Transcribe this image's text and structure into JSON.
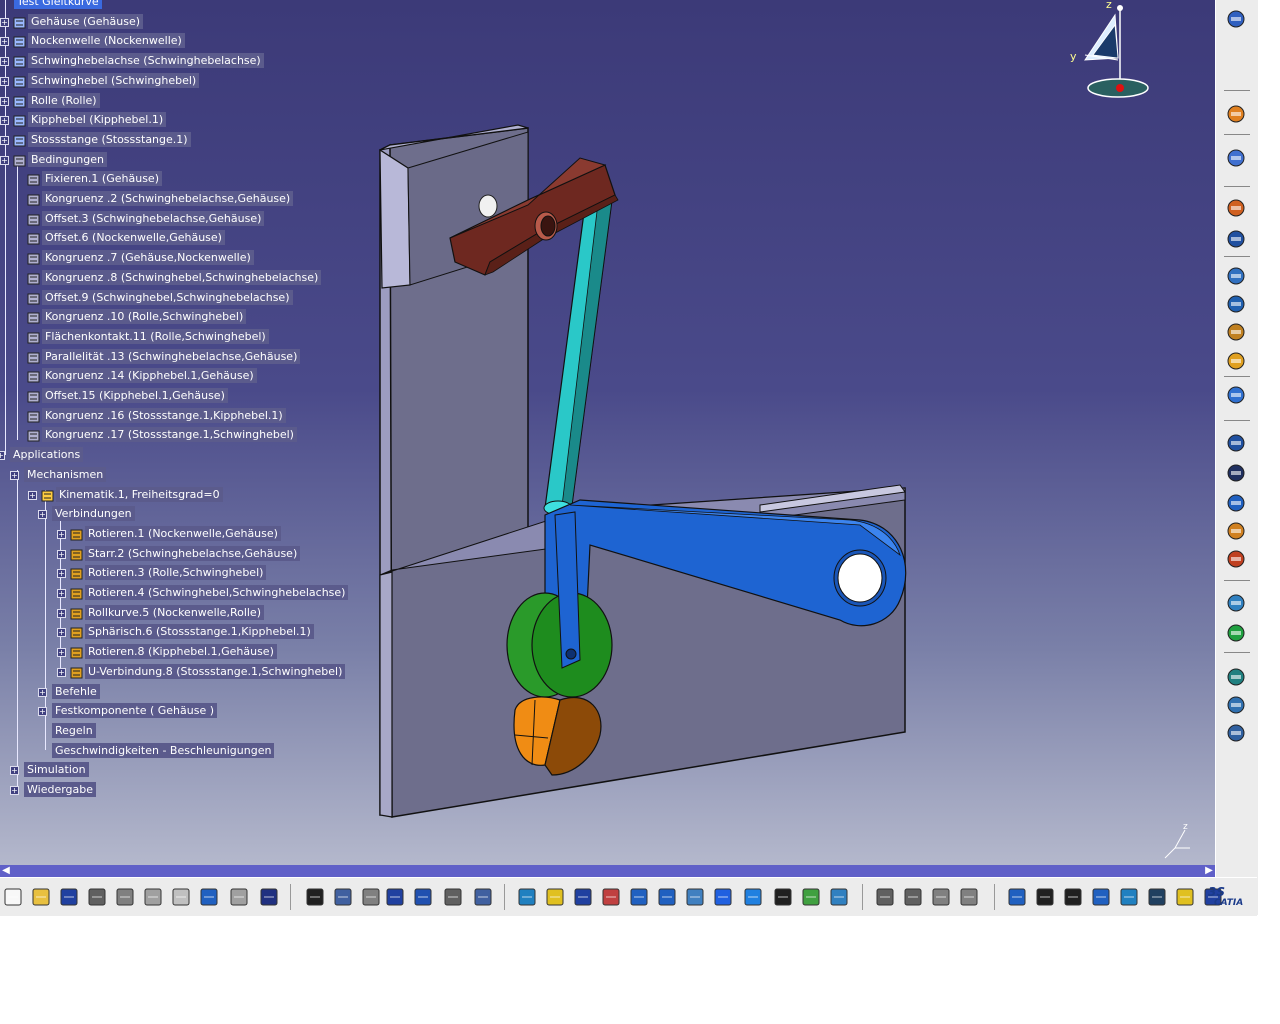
{
  "tree": {
    "root": "Test Gleitkurve",
    "parts": [
      "Gehäuse (Gehäuse)",
      "Nockenwelle (Nockenwelle)",
      "Schwinghebelachse (Schwinghebelachse)",
      "Schwinghebel (Schwinghebel)",
      "Rolle (Rolle)",
      "Kipphebel (Kipphebel.1)",
      "Stossstange (Stossstange.1)"
    ],
    "constraints_label": "Bedingungen",
    "constraints": [
      "Fixieren.1 (Gehäuse)",
      "Kongruenz .2 (Schwinghebelachse,Gehäuse)",
      "Offset.3 (Schwinghebelachse,Gehäuse)",
      "Offset.6 (Nockenwelle,Gehäuse)",
      "Kongruenz .7 (Gehäuse,Nockenwelle)",
      "Kongruenz .8 (Schwinghebel,Schwinghebelachse)",
      "Offset.9 (Schwinghebel,Schwinghebelachse)",
      "Kongruenz .10 (Rolle,Schwinghebel)",
      "Flächenkontakt.11 (Rolle,Schwinghebel)",
      "Parallelität .13 (Schwinghebelachse,Gehäuse)",
      "Kongruenz .14 (Kipphebel.1,Gehäuse)",
      "Offset.15 (Kipphebel.1,Gehäuse)",
      "Kongruenz .16 (Stossstange.1,Kipphebel.1)",
      "Kongruenz .17 (Stossstange.1,Schwinghebel)"
    ],
    "applications_label": "Applications",
    "mechanisms_label": "Mechanismen",
    "kinematics_label": "Kinematik.1, Freiheitsgrad=0",
    "joints_label": "Verbindungen",
    "joints": [
      "Rotieren.1 (Nockenwelle,Gehäuse)",
      "Starr.2 (Schwinghebelachse,Gehäuse)",
      "Rotieren.3 (Rolle,Schwinghebel)",
      "Rotieren.4 (Schwinghebel,Schwinghebelachse)",
      "Rollkurve.5 (Nockenwelle,Rolle)",
      "Sphärisch.6 (Stossstange.1,Kipphebel.1)",
      "Rotieren.8 (Kipphebel.1,Gehäuse)",
      "U-Verbindung.8 (Stossstange.1,Schwinghebel)"
    ],
    "mech_children": [
      "Befehle",
      "Festkomponente ( Gehäuse )",
      "Regeln",
      "Geschwindigkeiten - Beschleunigungen"
    ],
    "app_children": [
      "Simulation",
      "Wiedergabe"
    ]
  },
  "compass": {
    "z_label": "z",
    "y_label": "y"
  },
  "axis_mini": {
    "z_label": "z"
  },
  "colors": {
    "viewport_top": "#3c3a78",
    "viewport_bottom": "#b4b8cc",
    "tree_node_bg": "#5b5b8c",
    "tree_selected_bg": "#3a6ae0",
    "housing": "#6e6e8c",
    "rocker": "#1e64d2",
    "pushrod": "#2ac8c8",
    "roller": "#1e8c1e",
    "cam": "#f08c14",
    "lever": "#6e2820"
  },
  "right_toolbar_icons": [
    "space-analysis-icon",
    "select-arrow-icon",
    "fly-mode-icon",
    "manipulation-icon",
    "snap-icon",
    "constraint-icon",
    "anchor-icon",
    "fix-icon",
    "explode-icon",
    "update-icon",
    "catalog-icon",
    "simulation-icon",
    "mechanism-icon",
    "joint-icon",
    "speed-icon",
    "sensor-icon",
    "clash-icon",
    "kinematics-icon",
    "trace-icon",
    "envelope-icon"
  ],
  "bottom_toolbar_icons": [
    "new-icon",
    "open-icon",
    "save-icon",
    "print-icon",
    "cut-icon",
    "copy-icon",
    "paste-icon",
    "undo-icon",
    "redo-icon",
    "whats-this-icon",
    "formula-icon",
    "comment-icon",
    "knowledge-icon",
    "table-icon",
    "tree-expand-icon",
    "lock-icon",
    "measure-icon",
    "fit-all-icon",
    "zoom-area-icon",
    "pan-icon",
    "rotate-icon",
    "zoom-in-icon",
    "zoom-out-icon",
    "normal-view-icon",
    "multi-view-icon",
    "iso-view-icon",
    "hide-show-icon",
    "swap-icon",
    "shading-icon",
    "analysis-icon",
    "prev-icon",
    "next-icon",
    "compare-icon",
    "compare2-icon",
    "compass-icon",
    "first-icon",
    "last-icon",
    "search-icon",
    "split-icon",
    "color-icon",
    "render-icon",
    "catalog-icon",
    "catia-logo-icon"
  ],
  "catia_logo_text": "CATIA"
}
